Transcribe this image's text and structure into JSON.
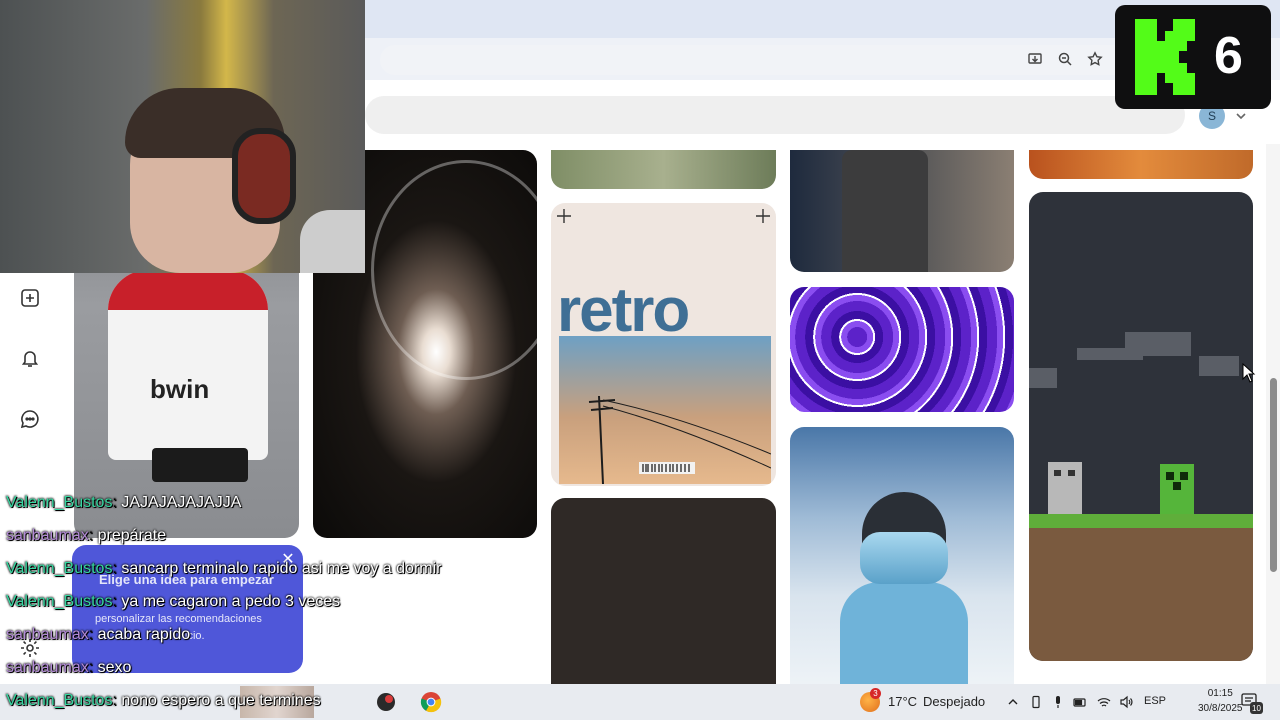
{
  "popup": {
    "title": "Elige una idea para empezar",
    "body_line1": "personalizar las recomendaciones",
    "body_line2": "icio.",
    "close_label": "✕"
  },
  "kick": {
    "number": "6",
    "brand_color": "#53fc18"
  },
  "header": {
    "avatar_initial": "S"
  },
  "pins": {
    "kid_shirt_text": "bwin",
    "retro_title": "retro"
  },
  "chat": {
    "user_colors": {
      "Valenn_Bustos": "#37d6a0",
      "sanbaumax": "#b38ad6"
    },
    "messages": [
      {
        "user": "Valenn_Bustos",
        "text": "JAJAJAJAJAJJA"
      },
      {
        "user": "sanbaumax",
        "text": "prepárate"
      },
      {
        "user": "Valenn_Bustos",
        "text": "sancarp terminalo rapido asi me voy a dormir"
      },
      {
        "user": "Valenn_Bustos",
        "text": "ya me cagaron a pedo 3 veces"
      },
      {
        "user": "sanbaumax",
        "text": "acaba rapido"
      },
      {
        "user": "sanbaumax",
        "text": "sexo"
      },
      {
        "user": "Valenn_Bustos",
        "text": "nono espero a que termines"
      }
    ]
  },
  "taskbar": {
    "weather_badge": "3",
    "temperature": "17°C",
    "condition": "Despejado",
    "language": "ESP",
    "time": "01:15",
    "date": "30/8/2025",
    "notification_count": "10"
  }
}
